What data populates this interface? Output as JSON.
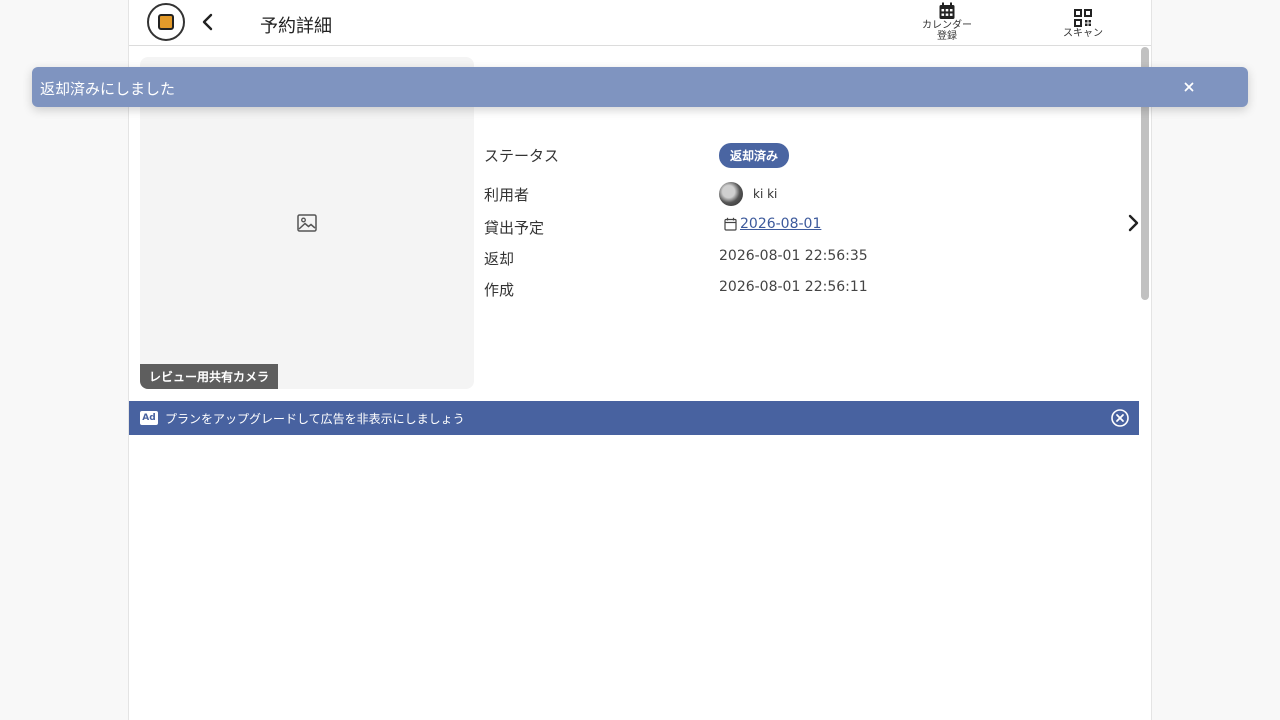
{
  "header": {
    "title": "予約詳細",
    "calendar_label_line1": "カレンダー",
    "calendar_label_line2": "登録",
    "scan_label": "スキャン"
  },
  "toast": {
    "message": "返却済みにしました"
  },
  "item": {
    "name": "レビュー用共有カメラ"
  },
  "details": {
    "status_key": "ステータス",
    "status_value": "返却済み",
    "user_key": "利用者",
    "user_name": "ki ki",
    "scheduled_key": "貸出予定",
    "scheduled_value": "2026-08-01",
    "returned_key": "返却",
    "returned_value": "2026-08-01 22:56:35",
    "created_key": "作成",
    "created_value": "2026-08-01 22:56:11"
  },
  "ad": {
    "badge": "Ad",
    "text": "プランをアップグレードして広告を非表示にしましょう"
  },
  "colors": {
    "primary": "#4862a0",
    "toast_bg": "#7f94c0",
    "link": "#3d5a9c"
  },
  "icons": {
    "back": "chevron-left-icon",
    "calendar": "calendar-icon",
    "scan": "qr-scan-icon",
    "image": "image-placeholder-icon",
    "next": "chevron-right-icon",
    "close": "close-icon",
    "ad_close": "circle-close-icon"
  }
}
